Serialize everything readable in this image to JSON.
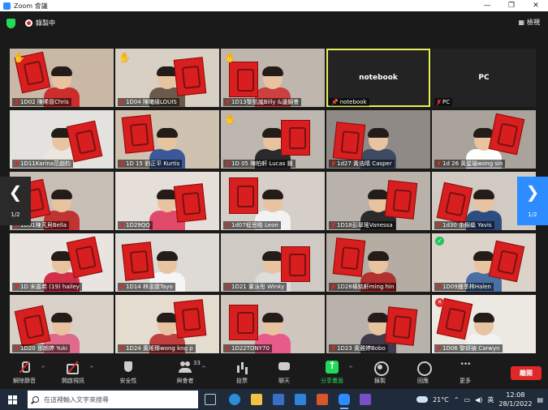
{
  "window": {
    "title": "Zoom 會議",
    "minimize": "—",
    "maximize": "❐",
    "close": "✕"
  },
  "topbar": {
    "recording_label": "錄製中",
    "view_label": "檢視"
  },
  "nav": {
    "left_page": "1/2",
    "right_page": "1/2"
  },
  "participants": [
    {
      "name": "1D02 陳晞晉Chris",
      "hand": true
    },
    {
      "name": "1D04 陳曦緣LOUIS",
      "hand": true
    },
    {
      "name": "1D13黎凱嵐Billy &邊錦會",
      "hand": true
    },
    {
      "name": "notebook",
      "noVideo": true,
      "active": true,
      "pinned": true
    },
    {
      "name": "PC",
      "noVideo": true
    },
    {
      "name": "1D11Karina范趙鈞"
    },
    {
      "name": "1D 15 劉正平 Kurtis"
    },
    {
      "name": "1D 05 陳柏軒 Lucas 鍾",
      "hand": true
    },
    {
      "name": "1d27 黃浩晴 Casper"
    },
    {
      "name": "1d 26 黃星瑜wong sin"
    },
    {
      "name": "1D01陳芃貝Bella"
    },
    {
      "name": "1D29QQ"
    },
    {
      "name": "1d07程思晧 Leon"
    },
    {
      "name": "1D18彭翠瑤Vanessa"
    },
    {
      "name": "1d30 余錦燊 Yavis"
    },
    {
      "name": "1D 宋嘉希 (19) hailey"
    },
    {
      "name": "1D14 林浚霆Tayo"
    },
    {
      "name": "1D21 董泳彤 Winky"
    },
    {
      "name": "1D28楊銘軒ming hin"
    },
    {
      "name": "1D09鍾季林Halen",
      "check": true
    },
    {
      "name": "1D20 鄧朗婷 Yuki"
    },
    {
      "name": "1D24 黃瑤臻wong kng p"
    },
    {
      "name": "1D22TONY70"
    },
    {
      "name": "1D23 黃雅婷Bobo"
    },
    {
      "name": "1D06 黎妍禎 Carwyn",
      "xmark": true
    }
  ],
  "toolbar": {
    "unmute": "解除靜音",
    "start_video": "開啟視訊",
    "security": "安全性",
    "participants": "與會者",
    "participants_count": "33",
    "polls": "投票",
    "chat": "聊天",
    "share": "分享畫面",
    "record": "錄製",
    "reactions": "回應",
    "more": "更多",
    "leave": "離開"
  },
  "taskbar": {
    "search_placeholder": "在這裡輸入文字來搜尋",
    "weather": "21°C",
    "ime": "英",
    "time": "12:08",
    "date": "28/1/2022"
  },
  "colors": {
    "accent": "#2d8cff",
    "share": "#23d959",
    "leave": "#e02828",
    "active_border": "#e6f05a"
  }
}
